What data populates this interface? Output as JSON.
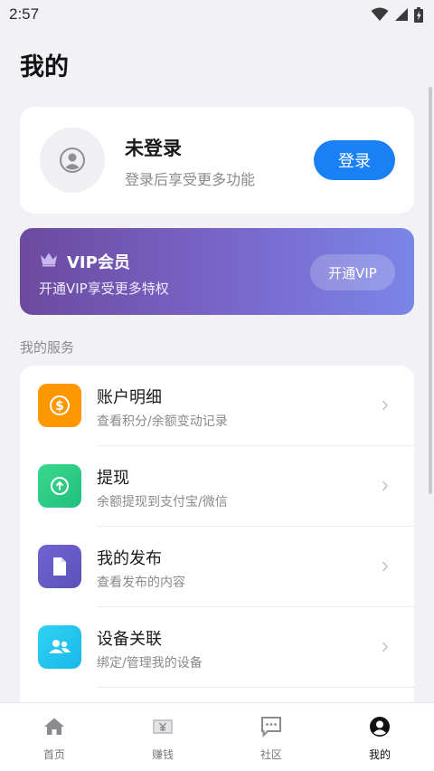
{
  "status_bar": {
    "time": "2:57"
  },
  "page": {
    "title": "我的"
  },
  "profile": {
    "name": "未登录",
    "subtitle": "登录后享受更多功能",
    "login_label": "登录",
    "login_color": "#1a80f5"
  },
  "vip": {
    "title": "VIP会员",
    "subtitle": "开通VIP享受更多特权",
    "button_label": "开通VIP",
    "icon": "crown-icon"
  },
  "services": {
    "section_label": "我的服务",
    "items": [
      {
        "title": "账户明细",
        "subtitle": "查看积分/余额变动记录",
        "icon": "coin-icon",
        "color": "#ff9800"
      },
      {
        "title": "提现",
        "subtitle": "余额提现到支付宝/微信",
        "icon": "withdraw-icon",
        "color": "#2ecc80"
      },
      {
        "title": "我的发布",
        "subtitle": "查看发布的内容",
        "icon": "document-icon",
        "color": "#6a5cc7"
      },
      {
        "title": "设备关联",
        "subtitle": "绑定/管理我的设备",
        "icon": "people-icon",
        "color": "#24c6ef"
      }
    ]
  },
  "bottom_nav": {
    "items": [
      {
        "label": "首页",
        "icon": "home-icon"
      },
      {
        "label": "赚钱",
        "icon": "money-icon"
      },
      {
        "label": "社区",
        "icon": "chat-icon"
      },
      {
        "label": "我的",
        "icon": "profile-icon",
        "active": true
      }
    ]
  }
}
